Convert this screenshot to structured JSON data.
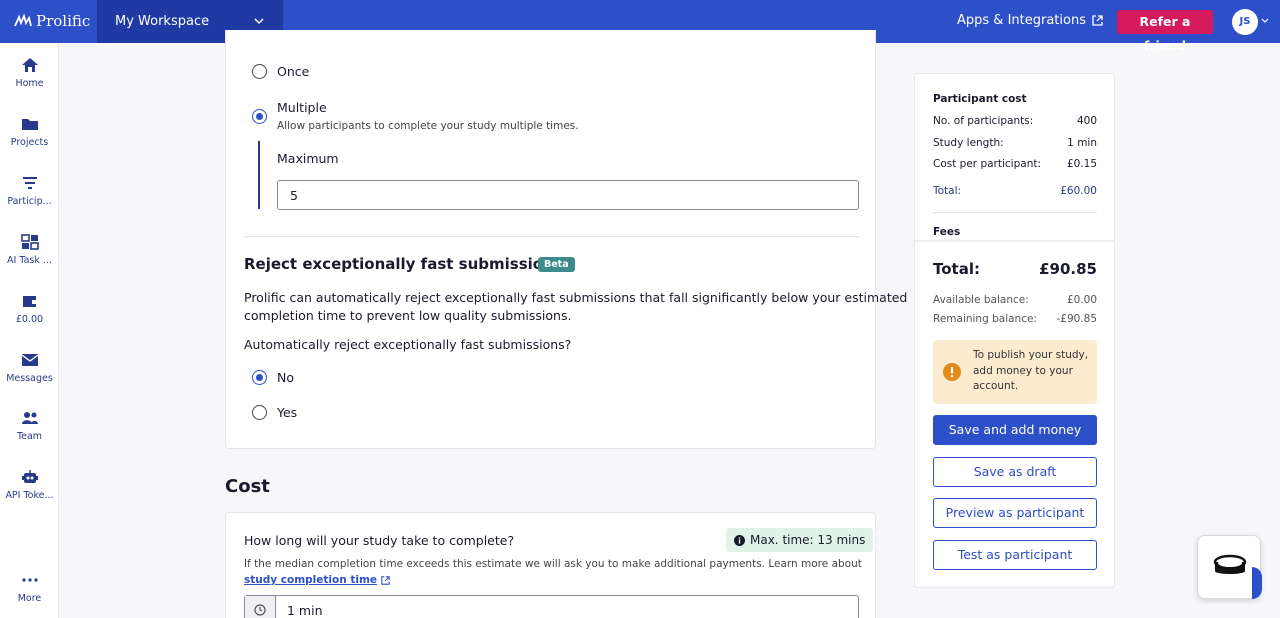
{
  "topbar": {
    "logo": "Prolific",
    "workspace": "My Workspace",
    "apps": "Apps & Integrations",
    "refer": "Refer a friend",
    "avatar": "JS"
  },
  "sidebar": {
    "items": [
      {
        "label": "Home",
        "icon": "home-icon"
      },
      {
        "label": "Projects",
        "icon": "folder-icon"
      },
      {
        "label": "Particip...",
        "icon": "filter-icon"
      },
      {
        "label": "AI Task ...",
        "icon": "dashboard-icon"
      },
      {
        "label": "£0.00",
        "icon": "wallet-icon"
      },
      {
        "label": "Messages",
        "icon": "mail-icon"
      },
      {
        "label": "Team",
        "icon": "team-icon"
      },
      {
        "label": "API Toke...",
        "icon": "robot-icon"
      },
      {
        "label": "More",
        "icon": "more-icon"
      }
    ]
  },
  "submissions": {
    "once_label": "Once",
    "multiple_label": "Multiple",
    "multiple_desc": "Allow participants to complete your study multiple times.",
    "maximum_label": "Maximum",
    "maximum_value": "5",
    "selected": "multiple"
  },
  "reject": {
    "title": "Reject exceptionally fast submissions",
    "badge": "Beta",
    "desc_line1": "Prolific can automatically reject exceptionally fast submissions that fall significantly below your estimated",
    "desc_line2": "completion time to prevent low quality submissions.",
    "question": "Automatically reject exceptionally fast submissions?",
    "no_label": "No",
    "yes_label": "Yes",
    "selected": "no"
  },
  "cost": {
    "heading": "Cost",
    "question": "How long will your study take to complete?",
    "max_time": "Max. time: 13 mins",
    "note": "If the median completion time exceeds this estimate we will ask you to make additional payments. Learn more about",
    "link": "study completion time",
    "duration_value": "1 min"
  },
  "panel": {
    "participant_cost_title": "Participant cost",
    "rows": [
      {
        "label": "No. of participants:",
        "value": "400"
      },
      {
        "label": "Study length:",
        "value": "1 min"
      },
      {
        "label": "Cost per participant:",
        "value": "£0.15"
      }
    ],
    "subtotal_label": "Total:",
    "subtotal_value": "£60.00",
    "fees_title": "Fees",
    "total_label": "Total:",
    "total_value": "£90.85",
    "available_label": "Available balance:",
    "available_value": "£0.00",
    "remaining_label": "Remaining balance:",
    "remaining_value": "-£90.85",
    "warning": "To publish your study, add money to your account.",
    "btn_save_money": "Save and add money",
    "btn_draft": "Save as draft",
    "btn_preview": "Preview as participant",
    "btn_test": "Test as participant"
  },
  "colors": {
    "brand": "#2d4fc7",
    "refer": "#d6195c",
    "beta": "#3c8c8c",
    "warning_bg": "#fdebd0",
    "warning_icon": "#e08a1a"
  }
}
